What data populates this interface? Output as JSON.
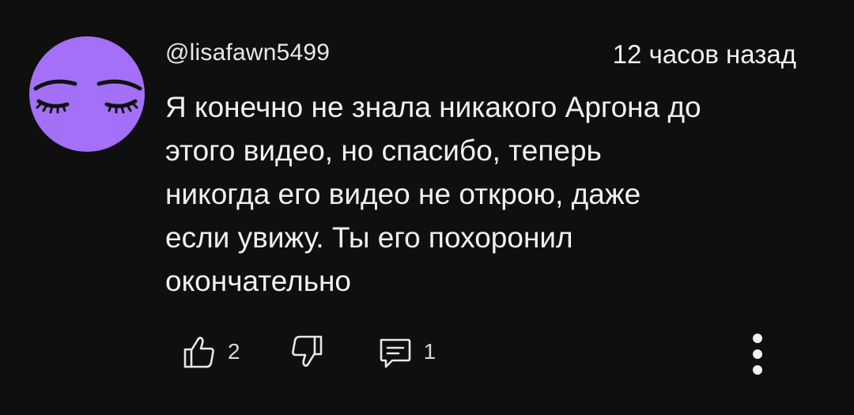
{
  "comment": {
    "author": "@lisafawn5499",
    "timestamp": "12 часов назад",
    "text": "Я конечно не знала никакого Аргона до\nэтого видео, но спасибо, теперь\nникогда его видео не открою, даже\nесли увижу. Ты его похоронил\nокончательно",
    "avatar_color": "#a370f7"
  },
  "actions": {
    "like_icon": "thumbs-up-icon",
    "like_count": "2",
    "dislike_icon": "thumbs-down-icon",
    "reply_icon": "comment-icon",
    "reply_count": "1",
    "more_icon": "more-vertical-icon"
  }
}
